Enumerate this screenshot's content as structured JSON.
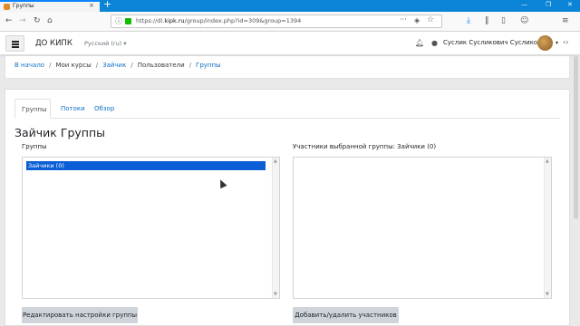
{
  "browser": {
    "tab_title": "Группы",
    "tab_close": "×",
    "new_tab": "+",
    "window_controls": [
      "—",
      "❐",
      "✕"
    ],
    "nav_icons": [
      "back-icon",
      "forward-icon",
      "reload-icon",
      "home-icon"
    ],
    "url_prefix": "https://dl.",
    "url_domain": "kipk.ru",
    "url_path": "/group/index.php?id=309&group=1394",
    "url_more": "···",
    "toolbar_icons": [
      "download-icon",
      "library-icon",
      "sidebar-icon",
      "account-icon",
      "menu-icon"
    ],
    "colors": {
      "tabstrip": "#0a84d6",
      "lock": "#12bc00"
    }
  },
  "header": {
    "brand": "ДО КИПК",
    "language": "Русский (ru) ▾",
    "user_name": "Суслик Сусликович Сусликов",
    "user_caret": "▾"
  },
  "breadcrumb": {
    "items": [
      "В начало",
      "Мои курсы",
      "Зайчик",
      "Пользователи",
      "Группы"
    ],
    "separator": "/"
  },
  "tabs": [
    "Группы",
    "Потоки",
    "Обзор"
  ],
  "page_title": "Зайчик Группы",
  "groups": {
    "label": "Группы",
    "options": [
      "Зайчики (0)"
    ],
    "selected": "Зайчики (0)",
    "button": "Редактировать настройки группы"
  },
  "members": {
    "label": "Участники выбранной группы: Зайчики (0)",
    "options": [],
    "button": "Добавить/удалить участников"
  },
  "colors": {
    "link": "#0f6fc5",
    "selection": "#0a5fd6",
    "button_bg": "#ced4da"
  }
}
